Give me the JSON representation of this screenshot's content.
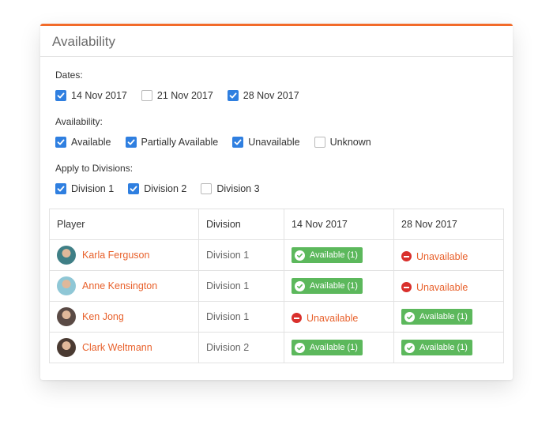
{
  "panel": {
    "title": "Availability"
  },
  "filters": {
    "dates": {
      "label": "Dates:",
      "options": [
        {
          "label": "14 Nov 2017",
          "checked": true
        },
        {
          "label": "21 Nov 2017",
          "checked": false
        },
        {
          "label": "28 Nov 2017",
          "checked": true
        }
      ]
    },
    "availability": {
      "label": "Availability:",
      "options": [
        {
          "label": "Available",
          "checked": true
        },
        {
          "label": "Partially Available",
          "checked": true
        },
        {
          "label": "Unavailable",
          "checked": true
        },
        {
          "label": "Unknown",
          "checked": false
        }
      ]
    },
    "divisions": {
      "label": "Apply to Divisions:",
      "options": [
        {
          "label": "Division 1",
          "checked": true
        },
        {
          "label": "Division 2",
          "checked": true
        },
        {
          "label": "Division 3",
          "checked": false
        }
      ]
    }
  },
  "table": {
    "headers": [
      "Player",
      "Division",
      "14 Nov 2017",
      "28 Nov 2017"
    ],
    "rows": [
      {
        "player": "Karla Ferguson",
        "division": "Division 1",
        "d1": "Available (1)",
        "d2": "Unavailable",
        "d1_status": "available",
        "d2_status": "unavailable",
        "avatar_color": "#3f7f86"
      },
      {
        "player": "Anne Kensington",
        "division": "Division 1",
        "d1": "Available (1)",
        "d2": "Unavailable",
        "d1_status": "available",
        "d2_status": "unavailable",
        "avatar_color": "#8fc7d6"
      },
      {
        "player": "Ken Jong",
        "division": "Division 1",
        "d1": "Unavailable",
        "d2": "Available (1)",
        "d1_status": "unavailable",
        "d2_status": "available",
        "avatar_color": "#5a4a45"
      },
      {
        "player": "Clark Weltmann",
        "division": "Division 2",
        "d1": "Available (1)",
        "d2": "Available (1)",
        "d1_status": "available",
        "d2_status": "available",
        "avatar_color": "#4a3a32"
      }
    ]
  },
  "colors": {
    "accent": "#f26b2a",
    "checkbox": "#2f7fe0",
    "available": "#5cb85c",
    "unavailable": "#d9302c",
    "link": "#e8612c"
  }
}
